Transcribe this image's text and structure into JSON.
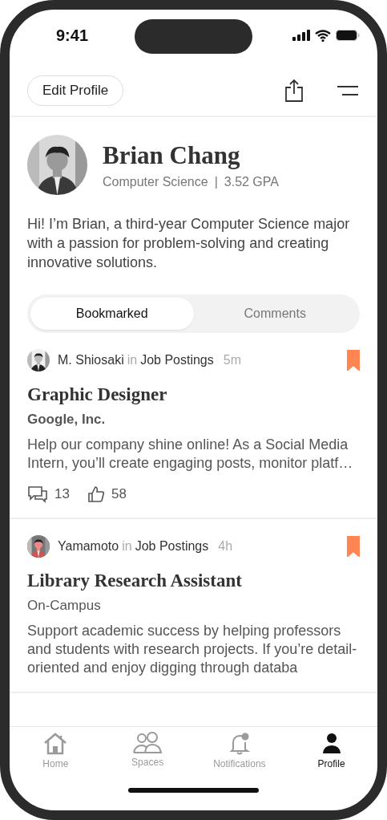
{
  "status_bar": {
    "time": "9:41"
  },
  "header": {
    "edit_button": "Edit Profile"
  },
  "profile": {
    "name": "Brian Chang",
    "major": "Computer Science",
    "separator": "|",
    "gpa": "3.52 GPA",
    "bio": "Hi! I’m Brian, a third-year Computer Science major with a passion for problem-solving and creating innovative solutions."
  },
  "tabs": [
    {
      "label": "Bookmarked",
      "selected": true
    },
    {
      "label": "Comments",
      "selected": false
    }
  ],
  "posts": [
    {
      "author": "M. Shiosaki",
      "in": "in",
      "space": "Job Postings",
      "time": "5m",
      "bookmarked": true,
      "title": "Graphic Designer",
      "org": "Google, Inc.",
      "org_bold": true,
      "body": "Help our company shine online! As a Social Media Intern, you’ll create engaging posts, monitor platf…",
      "comments": "13",
      "likes": "58"
    },
    {
      "author": "Yamamoto",
      "in": "in",
      "space": "Job Postings",
      "time": "4h",
      "bookmarked": true,
      "title": "Library Research Assistant",
      "org": "On-Campus",
      "org_bold": false,
      "body": "Support academic success by helping professors and students with research projects. If you’re detail-oriented and enjoy digging through databa"
    }
  ],
  "nav": [
    {
      "label": "Home",
      "kind": "home",
      "selected": false
    },
    {
      "label": "Spaces",
      "kind": "spaces",
      "selected": false
    },
    {
      "label": "Notifications",
      "kind": "notifications",
      "selected": false,
      "unread": true
    },
    {
      "label": "Profile",
      "kind": "profile",
      "selected": true
    }
  ]
}
